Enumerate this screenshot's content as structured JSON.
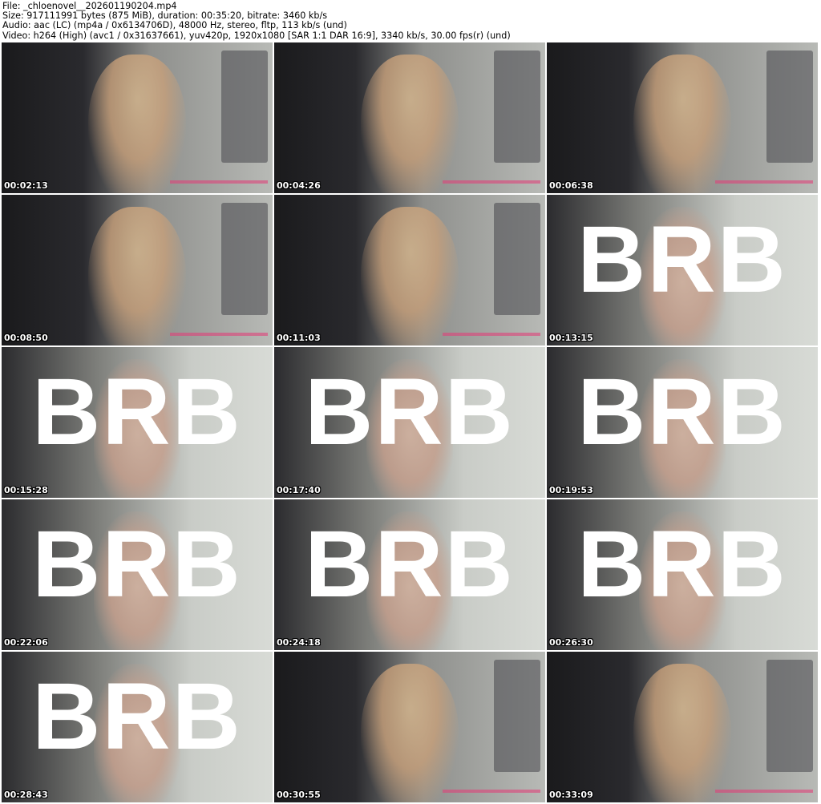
{
  "header": {
    "file": "File: _chloenovel__202601190204.mp4",
    "size": "Size: 917111991 bytes (875 MiB), duration: 00:35:20, bitrate: 3460 kb/s",
    "audio": "Audio: aac (LC) (mp4a / 0x6134706D), 48000 Hz, stereo, fltp, 113 kb/s (und)",
    "video": "Video: h264 (High) (avc1 / 0x31637661), yuv420p, 1920x1080 [SAR 1:1 DAR 16:9], 3340 kb/s, 30.00 fps(r) (und)"
  },
  "overlay_text": "BRB",
  "thumbnails": [
    {
      "time": "00:02:13",
      "brb": false
    },
    {
      "time": "00:04:26",
      "brb": false
    },
    {
      "time": "00:06:38",
      "brb": false
    },
    {
      "time": "00:08:50",
      "brb": false
    },
    {
      "time": "00:11:03",
      "brb": false
    },
    {
      "time": "00:13:15",
      "brb": true
    },
    {
      "time": "00:15:28",
      "brb": true
    },
    {
      "time": "00:17:40",
      "brb": true
    },
    {
      "time": "00:19:53",
      "brb": true
    },
    {
      "time": "00:22:06",
      "brb": true
    },
    {
      "time": "00:24:18",
      "brb": true
    },
    {
      "time": "00:26:30",
      "brb": true
    },
    {
      "time": "00:28:43",
      "brb": true
    },
    {
      "time": "00:30:55",
      "brb": false
    },
    {
      "time": "00:33:09",
      "brb": false
    }
  ]
}
